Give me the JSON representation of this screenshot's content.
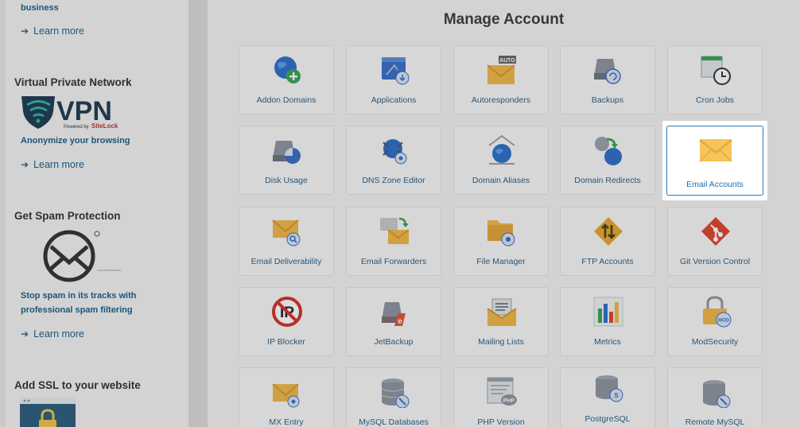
{
  "sidebar": {
    "business_text": "business",
    "learn_more": "Learn more",
    "vpn": {
      "title": "Virtual Private Network",
      "logo_text": "VPN",
      "powered_by": "Powered by",
      "sitelock": "SiteLock",
      "desc": "Anonymize your browsing"
    },
    "spam": {
      "title": "Get Spam Protection",
      "desc": "Stop spam in its tracks with professional spam filtering"
    },
    "ssl": {
      "title": "Add SSL to your website"
    }
  },
  "main": {
    "title": "Manage Account",
    "tiles": [
      {
        "label": "Addon Domains",
        "icon": "globe-plus-icon"
      },
      {
        "label": "Applications",
        "icon": "applications-icon"
      },
      {
        "label": "Autoresponders",
        "icon": "autoresponder-icon",
        "badge": "AUTO"
      },
      {
        "label": "Backups",
        "icon": "backup-drive-icon"
      },
      {
        "label": "Cron Jobs",
        "icon": "cron-clock-icon"
      },
      {
        "label": "Disk Usage",
        "icon": "disk-usage-icon"
      },
      {
        "label": "DNS Zone Editor",
        "icon": "dns-zone-icon"
      },
      {
        "label": "Domain Aliases",
        "icon": "domain-alias-icon"
      },
      {
        "label": "Domain Redirects",
        "icon": "domain-redirect-icon"
      },
      {
        "label": "Email Accounts",
        "icon": "envelope-icon"
      },
      {
        "label": "Email Deliverability",
        "icon": "email-deliverability-icon"
      },
      {
        "label": "Email Forwarders",
        "icon": "email-forwarder-icon"
      },
      {
        "label": "File Manager",
        "icon": "file-manager-icon"
      },
      {
        "label": "FTP Accounts",
        "icon": "ftp-icon"
      },
      {
        "label": "Git Version Control",
        "icon": "git-icon"
      },
      {
        "label": "IP Blocker",
        "icon": "ip-blocker-icon",
        "badge": "IP"
      },
      {
        "label": "JetBackup",
        "icon": "jetbackup-icon"
      },
      {
        "label": "Mailing Lists",
        "icon": "mailing-list-icon"
      },
      {
        "label": "Metrics",
        "icon": "metrics-icon"
      },
      {
        "label": "ModSecurity",
        "icon": "modsecurity-icon",
        "badge": "MOD"
      },
      {
        "label": "MX Entry",
        "icon": "mx-entry-icon"
      },
      {
        "label": "MySQL Databases",
        "icon": "mysql-icon"
      },
      {
        "label": "PHP Version",
        "icon": "php-icon",
        "badge": "PHP"
      },
      {
        "label": "PostgreSQL",
        "icon": "postgresql-icon"
      },
      {
        "label": "Remote MySQL",
        "icon": "remote-mysql-icon"
      }
    ]
  },
  "colors": {
    "accent": "#1d6fb0",
    "label": "#2a5f87",
    "envelope": "#f5c45a"
  }
}
